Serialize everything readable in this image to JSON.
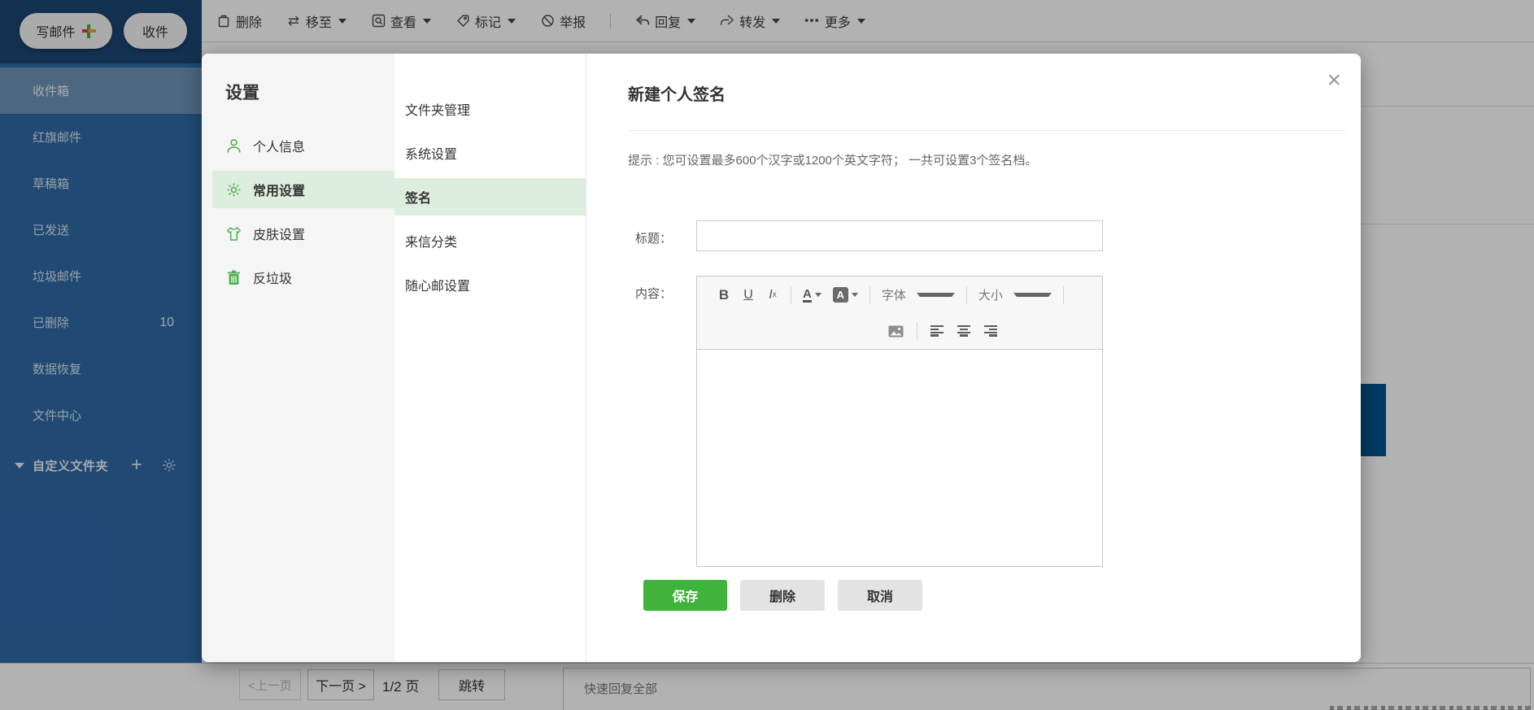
{
  "compose": {
    "label": "写邮件"
  },
  "receive": {
    "label": "收件"
  },
  "toolbar": {
    "delete": "删除",
    "move": "移至",
    "view": "查看",
    "mark": "标记",
    "report": "举报",
    "reply": "回复",
    "forward": "转发",
    "more": "更多"
  },
  "sidebar": {
    "items": [
      {
        "label": "收件箱"
      },
      {
        "label": "红旗邮件"
      },
      {
        "label": "草稿箱"
      },
      {
        "label": "已发送"
      },
      {
        "label": "垃圾邮件"
      },
      {
        "label": "已删除",
        "badge": "10"
      },
      {
        "label": "数据恢复"
      },
      {
        "label": "文件中心"
      }
    ],
    "custom_folders": "自定义文件夹"
  },
  "settings": {
    "title": "设置",
    "nav": [
      {
        "label": "个人信息"
      },
      {
        "label": "常用设置"
      },
      {
        "label": "皮肤设置"
      },
      {
        "label": "反垃圾"
      }
    ],
    "subnav": [
      {
        "label": "文件夹管理"
      },
      {
        "label": "系统设置"
      },
      {
        "label": "签名"
      },
      {
        "label": "来信分类"
      },
      {
        "label": "随心邮设置"
      }
    ]
  },
  "panel": {
    "title": "新建个人签名",
    "hint": "提示 : 您可设置最多600个汉字或1200个英文字符； 一共可设置3个签名档。",
    "title_label": "标题：",
    "content_label": "内容：",
    "editor": {
      "bold": "B",
      "underline": "U",
      "font": "字体",
      "size": "大小"
    },
    "buttons": {
      "save": "保存",
      "delete": "删除",
      "cancel": "取消"
    }
  },
  "pagination": {
    "prev": "<上一页",
    "next": "下一页 >",
    "page": "1/2 页",
    "jump": "跳转"
  },
  "quick_reply": {
    "label": "快速回复全部"
  },
  "colors": {
    "accent_green": "#52b152",
    "save_green": "#3fb33c",
    "selected_green_bg": "#ddeede",
    "sidebar_blue": "#2e6aa7",
    "sidebar_top_navy": "#1a4571",
    "sidebar_selected": "#6e94b7",
    "background_blue_block": "#00538d"
  }
}
